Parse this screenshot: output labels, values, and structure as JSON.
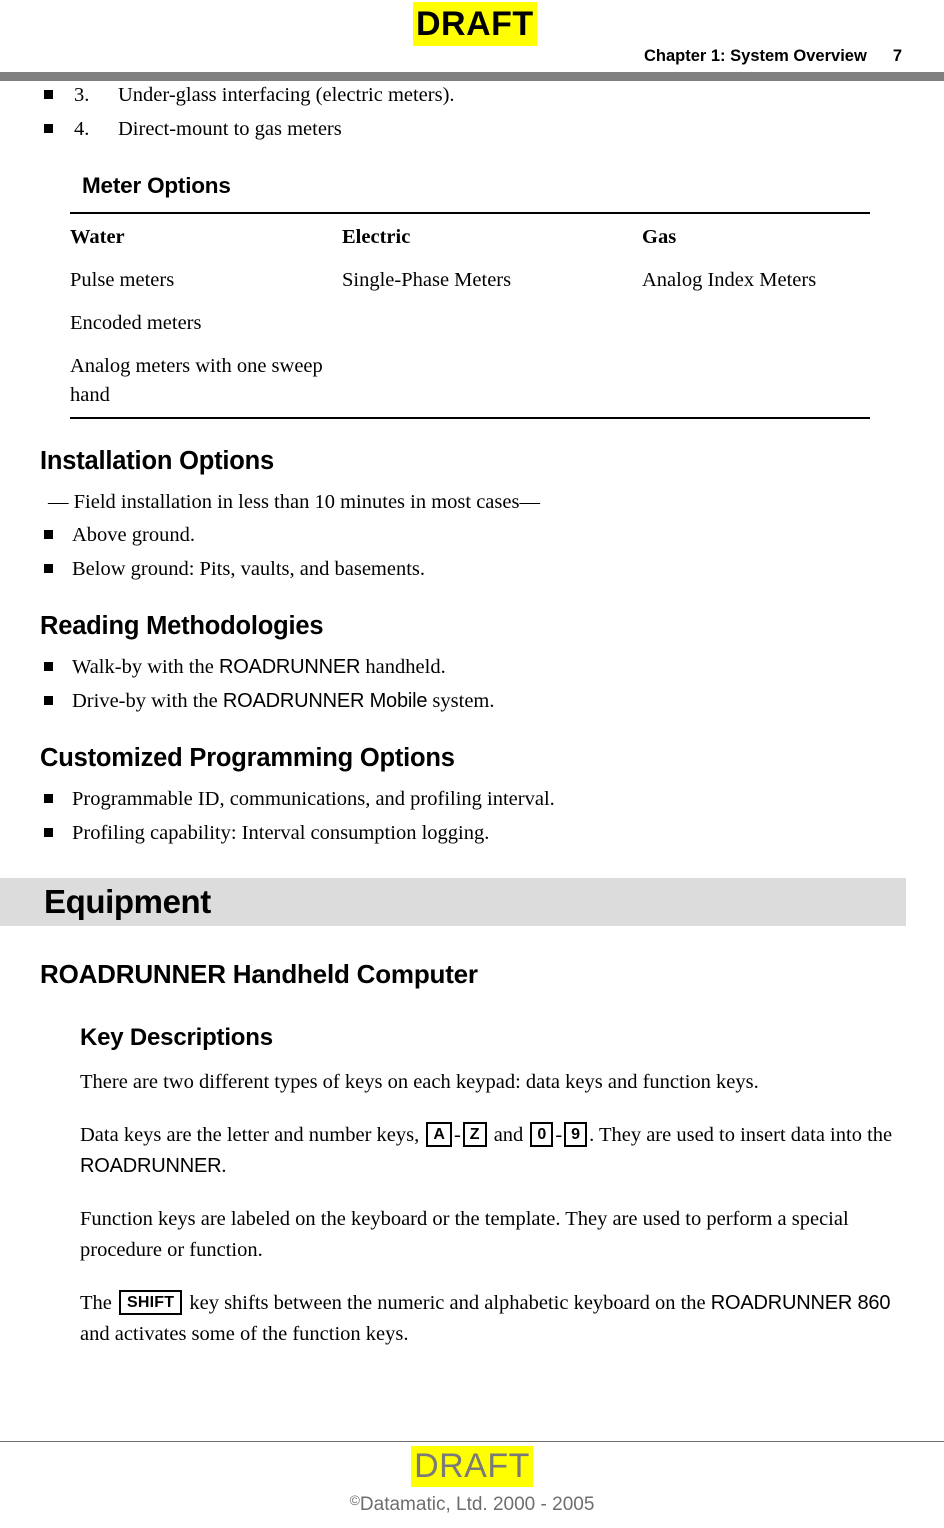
{
  "header": {
    "draft_watermark": "DRAFT",
    "chapter_title": "Chapter 1:  System Overview",
    "page_number": "7"
  },
  "top_list": [
    {
      "number": "3.",
      "text": "Under-glass interfacing (electric meters)."
    },
    {
      "number": "4.",
      "text": "Direct-mount to gas meters"
    }
  ],
  "meter_options": {
    "heading": "Meter Options",
    "columns": [
      "Water",
      "Electric",
      "Gas"
    ],
    "rows": [
      [
        "Pulse meters",
        "Single-Phase Meters",
        "Analog Index Meters"
      ],
      [
        "Encoded meters",
        "",
        ""
      ],
      [
        "Analog meters with one sweep hand",
        "",
        ""
      ]
    ]
  },
  "installation_options": {
    "heading": "Installation Options",
    "dash_line": "— Field installation in less than 10 minutes in most cases—",
    "bullets": [
      "Above ground.",
      "Below ground: Pits, vaults, and basements."
    ]
  },
  "reading_methodologies": {
    "heading": "Reading Methodologies",
    "bullets": [
      {
        "pre": "Walk-by with the ",
        "brand": "ROADRUNNER",
        "post": " handheld."
      },
      {
        "pre": "Drive-by with the ",
        "brand": "ROADRUNNER Mobile",
        "post": " system."
      }
    ]
  },
  "customized_programming": {
    "heading": "Customized Programming Options",
    "bullets": [
      "Programmable ID, communications, and profiling interval.",
      "Profiling capability: Interval consumption logging."
    ]
  },
  "equipment": {
    "banner_heading": "Equipment",
    "sub_heading": "ROADRUNNER Handheld Computer",
    "key_descriptions": {
      "heading": "Key Descriptions",
      "paragraph_1": "There are two different types of keys on each keypad: data keys and function keys.",
      "paragraph_2": {
        "part_1": "Data keys are the letter and number keys, ",
        "key_a": "A",
        "dash_1": "-",
        "key_z": "Z",
        "part_2": " and ",
        "key_0": "0",
        "dash_2": "-",
        "key_9": "9",
        "part_3": ". They are used to insert data into the ",
        "brand": "ROADRUNNER",
        "part_4": "."
      },
      "paragraph_3": "Function keys are labeled on the keyboard or the template. They are used to perform a special procedure or function.",
      "paragraph_4": {
        "part_1": "The ",
        "key_shift": "SHIFT",
        "part_2": " key shifts between the numeric and alphabetic keyboard on the ",
        "brand": "ROADRUNNER 860",
        "part_3": " and activates some of the function keys."
      }
    }
  },
  "footer": {
    "draft_watermark": "DRAFT",
    "copyright_mark": "©",
    "copyright_text": "Datamatic, Ltd. 2000 - 2005"
  },
  "colors": {
    "highlight": "#ffff00",
    "header_rule": "#808080",
    "banner_bg": "#dcdcdc",
    "footer_text": "#6e6e6e"
  }
}
